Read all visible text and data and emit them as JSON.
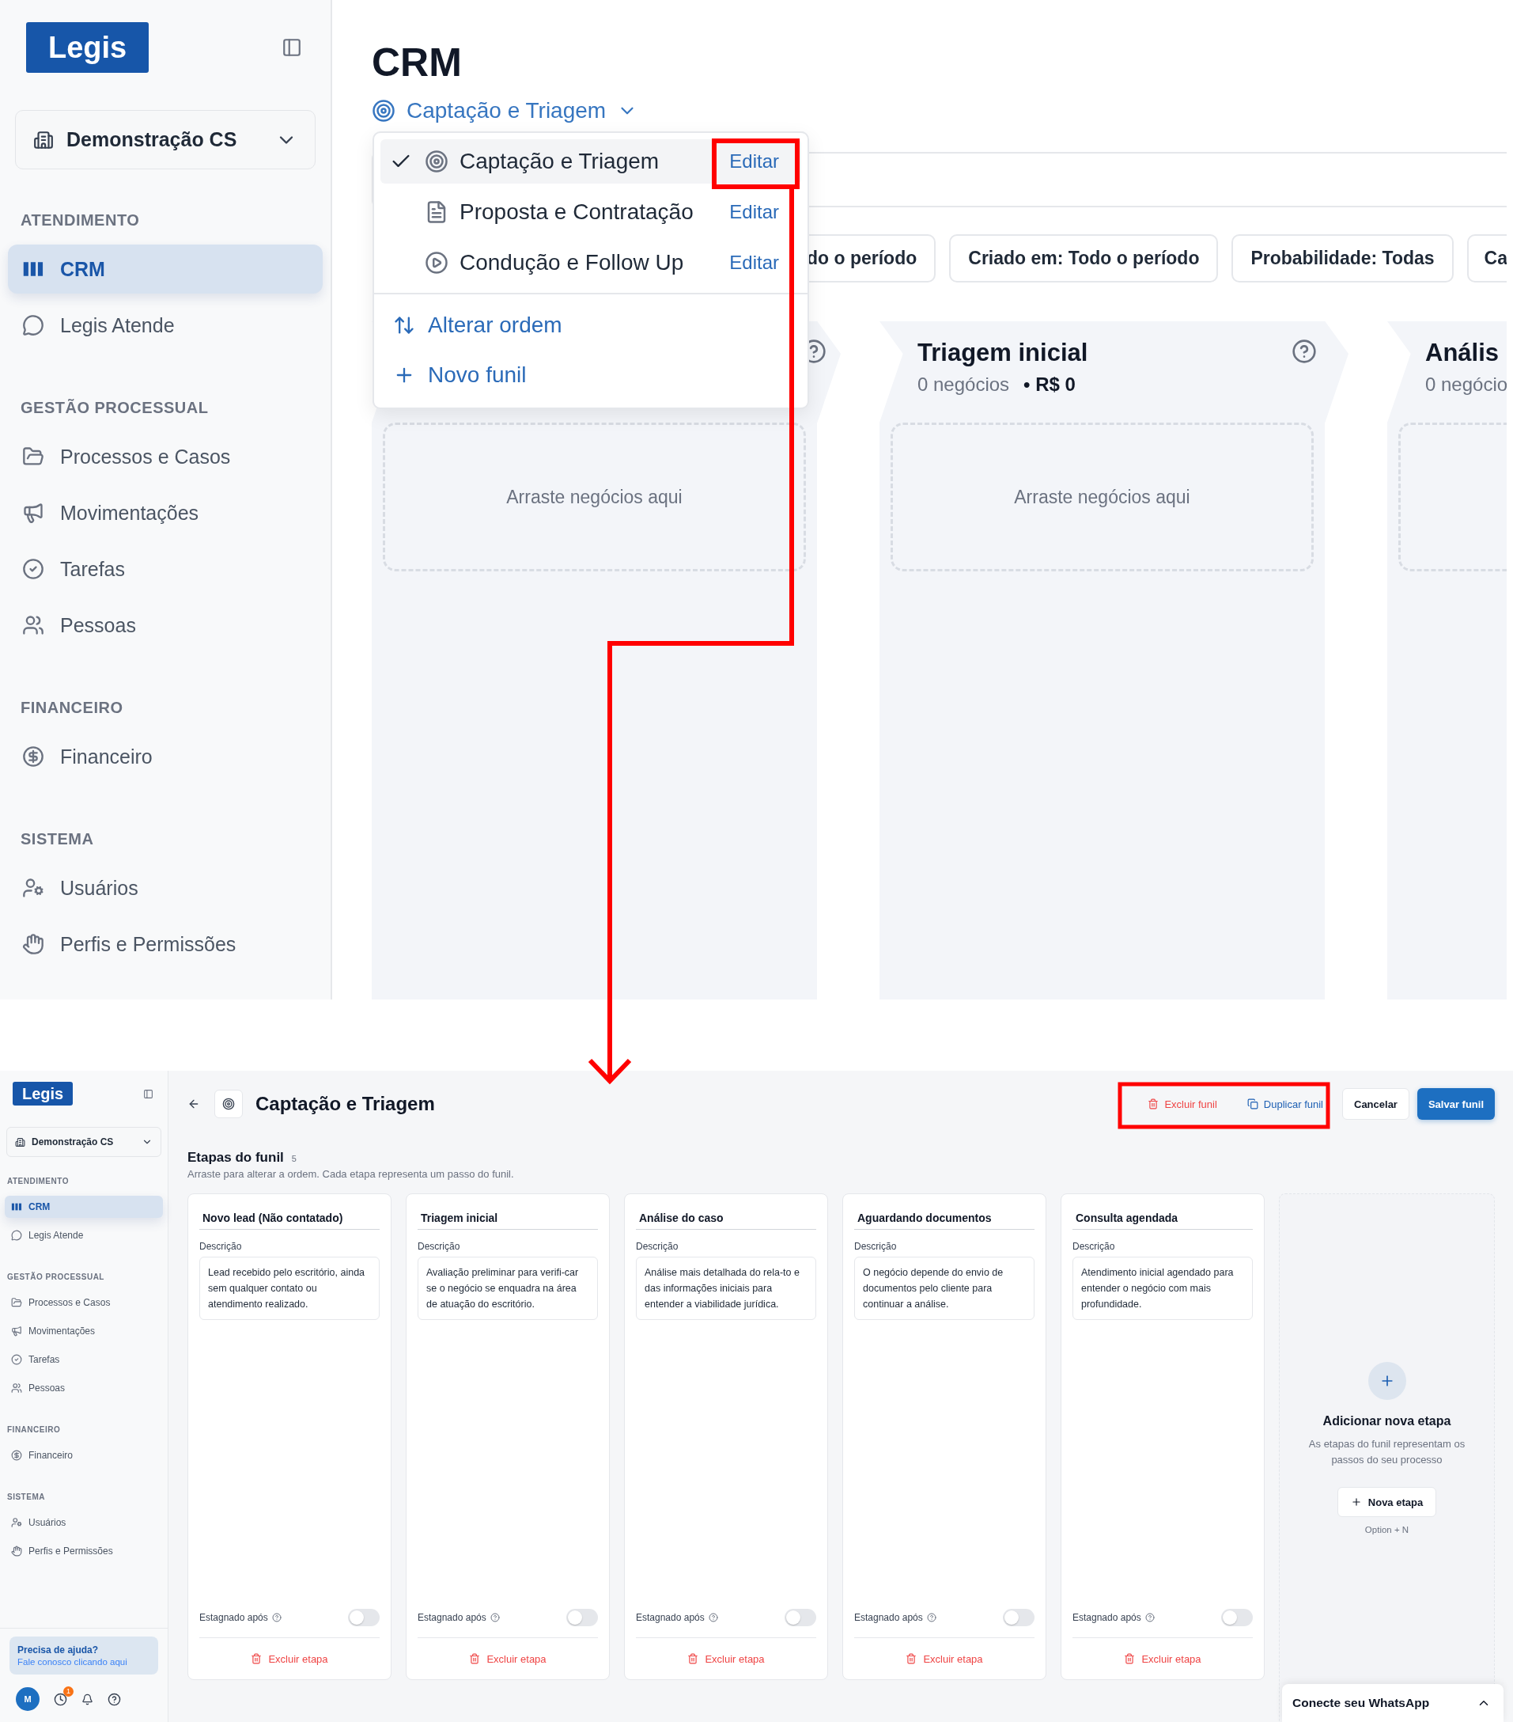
{
  "top_screen": {
    "sidebar": {
      "logo": "Legis",
      "workspace": "Demonstração CS",
      "sections": [
        {
          "title": "ATENDIMENTO",
          "items": [
            {
              "label": "CRM",
              "selected": true
            },
            {
              "label": "Legis Atende",
              "selected": false
            }
          ]
        },
        {
          "title": "GESTÃO PROCESSUAL",
          "items": [
            {
              "label": "Processos e Casos",
              "selected": false
            },
            {
              "label": "Movimentações",
              "selected": false
            },
            {
              "label": "Tarefas",
              "selected": false
            },
            {
              "label": "Pessoas",
              "selected": false
            }
          ]
        },
        {
          "title": "FINANCEIRO",
          "items": [
            {
              "label": "Financeiro",
              "selected": false
            }
          ]
        },
        {
          "title": "SISTEMA",
          "items": [
            {
              "label": "Usuários",
              "selected": false
            },
            {
              "label": "Perfis e Permissões",
              "selected": false
            }
          ]
        }
      ]
    },
    "page_title": "CRM",
    "funnel_selector": "Captação e Triagem",
    "funnel_menu": {
      "funnels": [
        {
          "name": "Captação e Triagem",
          "selected": true,
          "action": "Editar"
        },
        {
          "name": "Proposta e Contratação",
          "selected": false,
          "action": "Editar"
        },
        {
          "name": "Condução e Follow Up",
          "selected": false,
          "action": "Editar"
        }
      ],
      "actions": [
        "Alterar ordem",
        "Novo funil"
      ]
    },
    "filters": [
      "do o período",
      "Criado em: Todo o período",
      "Probabilidade: Todas",
      "Ca"
    ],
    "columns": [
      {
        "drop_hint": "Arraste negócios aqui"
      },
      {
        "title": "Triagem inicial",
        "count": "0 negócios",
        "total": "• R$ 0",
        "drop_hint": "Arraste negócios aqui"
      },
      {
        "title": "Anális",
        "count": "0 negócio"
      }
    ]
  },
  "bottom_screen": {
    "sidebar": {
      "logo": "Legis",
      "workspace": "Demonstração CS",
      "sections": [
        {
          "title": "ATENDIMENTO",
          "items": [
            {
              "label": "CRM",
              "selected": true
            },
            {
              "label": "Legis Atende",
              "selected": false
            }
          ]
        },
        {
          "title": "GESTÃO PROCESSUAL",
          "items": [
            {
              "label": "Processos e Casos",
              "selected": false
            },
            {
              "label": "Movimentações",
              "selected": false
            },
            {
              "label": "Tarefas",
              "selected": false
            },
            {
              "label": "Pessoas",
              "selected": false
            }
          ]
        },
        {
          "title": "FINANCEIRO",
          "items": [
            {
              "label": "Financeiro",
              "selected": false
            }
          ]
        },
        {
          "title": "SISTEMA",
          "items": [
            {
              "label": "Usuários",
              "selected": false
            },
            {
              "label": "Perfis e Permissões",
              "selected": false
            }
          ]
        }
      ]
    },
    "help": {
      "title": "Precisa de ajuda?",
      "link": "Fale conosco clicando aqui"
    },
    "user_initial": "M",
    "notification_count": "1",
    "header": {
      "title": "Captação e Triagem",
      "actions": [
        {
          "label": "Excluir funil",
          "kind": "danger"
        },
        {
          "label": "Duplicar funil",
          "kind": "link"
        },
        {
          "label": "Cancelar",
          "kind": "secondary"
        },
        {
          "label": "Salvar funil",
          "kind": "primary"
        }
      ]
    },
    "stages_title": "Etapas do funil",
    "stages_count": "5",
    "stages_hint": "Arraste para alterar a ordem. Cada etapa representa um passo do funil.",
    "stages": [
      {
        "name": "Novo lead (Não contatado)",
        "description_label": "Descrição",
        "description": "Lead recebido pelo escritório, ainda sem qualquer contato ou atendimento realizado.",
        "stalled_label": "Estagnado após",
        "stalled": false,
        "delete": "Excluir etapa"
      },
      {
        "name": "Triagem inicial",
        "description_label": "Descrição",
        "description": "Avaliação preliminar para verifi-car se o negócio se enquadra na área de atuação do escritório.",
        "stalled_label": "Estagnado após",
        "stalled": false,
        "delete": "Excluir etapa"
      },
      {
        "name": "Análise do caso",
        "description_label": "Descrição",
        "description": "Análise mais detalhada do rela-to e das informações iniciais para entender a viabilidade jurídica.",
        "stalled_label": "Estagnado após",
        "stalled": false,
        "delete": "Excluir etapa"
      },
      {
        "name": "Aguardando documentos",
        "description_label": "Descrição",
        "description": "O negócio depende do envio de documentos pelo cliente para continuar a análise.",
        "stalled_label": "Estagnado após",
        "stalled": false,
        "delete": "Excluir etapa"
      },
      {
        "name": "Consulta agendada",
        "description_label": "Descrição",
        "description": "Atendimento inicial agendado para entender o negócio com mais profundidade.",
        "stalled_label": "Estagnado após",
        "stalled": false,
        "delete": "Excluir etapa"
      }
    ],
    "add_stage": {
      "title": "Adicionar nova etapa",
      "text": "As etapas do funil representam os passos do seu processo",
      "button": "Nova etapa",
      "shortcut": "Option + N"
    },
    "whatsapp": "Conecte seu WhatsApp"
  }
}
